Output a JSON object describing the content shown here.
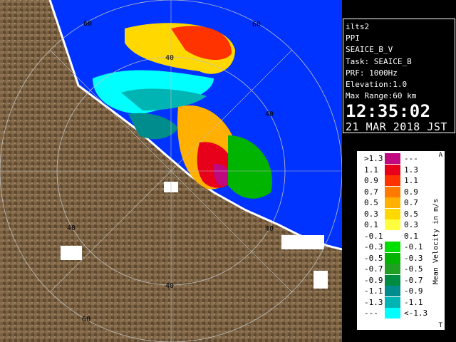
{
  "map": {
    "range_labels": [
      "60",
      "40",
      "40",
      "40",
      "40",
      "40",
      "60",
      "60"
    ]
  },
  "info": {
    "station": "ilts2",
    "product": "PPI",
    "task_name": "SEAICE_B_V",
    "task": "Task: SEAICE_B",
    "prf": "PRF: 1000Hz",
    "elevation": "Elevation:1.0",
    "max_range": "Max Range:60 km",
    "time": "12:35:02",
    "date": "21 MAR 2018 JST"
  },
  "legend": {
    "unit_label": "Mean Velocity in m/s",
    "corner_top": "A",
    "corner_bottom": "T",
    "rows": [
      {
        "low": ">1.3",
        "high": "---",
        "color": "#c0087f"
      },
      {
        "low": "1.1",
        "high": "1.3",
        "color": "#e8001a"
      },
      {
        "low": "0.9",
        "high": "1.1",
        "color": "#ff3300"
      },
      {
        "low": "0.7",
        "high": "0.9",
        "color": "#ff7a00"
      },
      {
        "low": "0.5",
        "high": "0.7",
        "color": "#ffb000"
      },
      {
        "low": "0.3",
        "high": "0.5",
        "color": "#ffd800"
      },
      {
        "low": "0.1",
        "high": "0.3",
        "color": "#ffff40"
      },
      {
        "low": "-0.1",
        "high": "0.1",
        "color": "#ffffff"
      },
      {
        "low": "-0.3",
        "high": "-0.1",
        "color": "#00e000"
      },
      {
        "low": "-0.5",
        "high": "-0.3",
        "color": "#00b400"
      },
      {
        "low": "-0.7",
        "high": "-0.5",
        "color": "#20a020"
      },
      {
        "low": "-0.9",
        "high": "-0.7",
        "color": "#008c40"
      },
      {
        "low": "-1.1",
        "high": "-0.9",
        "color": "#008c8c"
      },
      {
        "low": "-1.3",
        "high": "-1.1",
        "color": "#00b4b4"
      },
      {
        "low": "---",
        "high": "<-1.3",
        "color": "#00ffff"
      }
    ]
  }
}
